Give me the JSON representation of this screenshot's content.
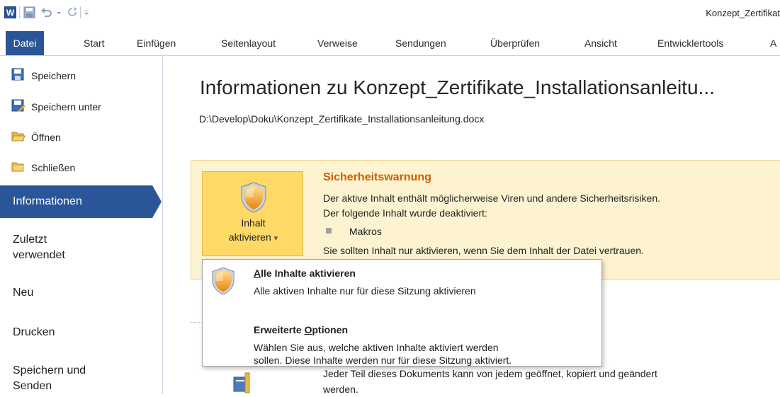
{
  "window": {
    "title": "Konzept_Zertifikat"
  },
  "ribbon": {
    "tabs": [
      "Datei",
      "Start",
      "Einfügen",
      "Seitenlayout",
      "Verweise",
      "Sendungen",
      "Überprüfen",
      "Ansicht",
      "Entwicklertools",
      "A"
    ]
  },
  "sidebar": {
    "commands": [
      "Speichern",
      "Speichern unter",
      "Öffnen",
      "Schließen"
    ],
    "items": [
      "Informationen",
      "Zuletzt verwendet",
      "Neu",
      "Drucken",
      "Speichern und Senden"
    ],
    "recent_line1": "Zuletzt",
    "recent_line2": "verwendet",
    "send_line1": "Speichern und",
    "send_line2": "Senden"
  },
  "main": {
    "title": "Informationen zu Konzept_Zertifikate_Installationsanleitu...",
    "path": "D:\\Develop\\Doku\\Konzept_Zertifikate_Installationsanleitung.docx"
  },
  "security": {
    "button_line1": "Inhalt",
    "button_line2": "aktivieren",
    "button_arrow": "▾",
    "title": "Sicherheitswarnung",
    "line1": "Der aktive Inhalt enthält möglicherweise Viren und andere Sicherheitsrisiken.",
    "line2": "Der folgende Inhalt wurde deaktiviert:",
    "bullet": "Makros",
    "line3": "Sie sollten Inhalt nur aktivieren, wenn Sie dem Inhalt der Datei vertrauen."
  },
  "dropdown": {
    "item1_title_underlined": "A",
    "item1_title_rest": "lle Inhalte aktivieren",
    "item1_desc": "Alle aktiven Inhalte nur für diese Sitzung aktivieren",
    "item2_title_pre": "Erweiterte ",
    "item2_title_underlined": "O",
    "item2_title_rest": "ptionen",
    "item2_desc_line1": "Wählen Sie aus, welche aktiven Inhalte aktiviert werden",
    "item2_desc_line2": "sollen. Diese Inhalte werden nur für diese Sitzung aktiviert."
  },
  "permissions": {
    "line1": "Jeder Teil dieses Dokuments kann von jedem geöffnet, kopiert und geändert",
    "line2": "werden."
  },
  "colors": {
    "accent": "#2a5699",
    "warning_title": "#d45b00",
    "warning_bg": "#fdf3d1",
    "button_bg": "#ffd966"
  }
}
